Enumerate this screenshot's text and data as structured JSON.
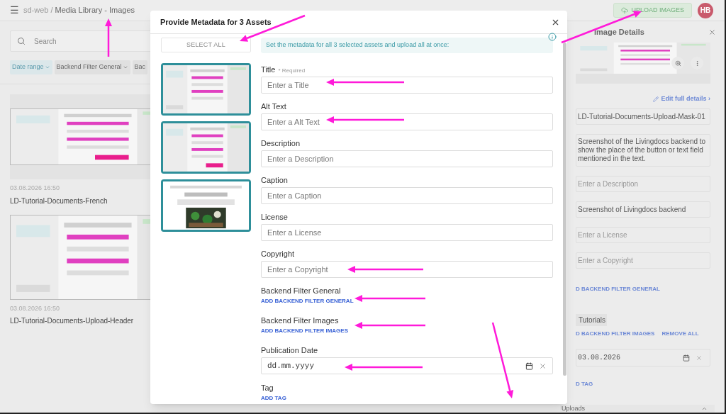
{
  "header": {
    "menu": "☰",
    "breadcrumb_root": "sd-web",
    "breadcrumb_separator": "/",
    "breadcrumb_page": "Media Library - Images",
    "upload_button": "UPLOAD IMAGES",
    "avatar": "HB"
  },
  "search": {
    "placeholder": "Search"
  },
  "filters": [
    {
      "label": "Date range",
      "selected": true
    },
    {
      "label": "Backend Filter General",
      "selected": false
    },
    {
      "label": "Bac",
      "selected": false
    }
  ],
  "assets": [
    {
      "kind": "picture",
      "date": "03.08.2026 16:50",
      "name": "LD-Tutorial-Documents-French"
    },
    {
      "kind": "picture",
      "date": "03.08.2026 16:50",
      "name": "LD-Tutorial-Documents-Upload-Header"
    }
  ],
  "details_panel": {
    "title": "Image Details",
    "edit_link": "Edit full details ›",
    "fields": [
      {
        "kind": "input",
        "value": "LD-Tutorial-Documents-Upload-Mask-01"
      },
      {
        "kind": "textarea",
        "value": "Screenshot of the Livingdocs backend to show the place of the button or text field mentioned in the text."
      },
      {
        "kind": "input",
        "placeholder": "Enter a Description"
      },
      {
        "kind": "input",
        "value": "Screenshot of Livingdocs backend"
      },
      {
        "kind": "input",
        "placeholder": "Enter a License"
      },
      {
        "kind": "input",
        "placeholder": "Enter a Copyright"
      },
      {
        "kind": "link",
        "links": [
          "D BACKEND FILTER GENERAL"
        ]
      },
      {
        "kind": "chips",
        "chips": [
          "Tutorials"
        ],
        "links": [
          "D BACKEND FILTER IMAGES",
          "REMOVE ALL"
        ]
      },
      {
        "kind": "date",
        "value": "03.08.2026"
      },
      {
        "kind": "link",
        "links": [
          "D TAG"
        ]
      }
    ]
  },
  "uploads_bar": {
    "label": "Uploads"
  },
  "modal": {
    "title": "Provide Metadata for 3 Assets",
    "select_all": "SELECT ALL",
    "info": "Set the metadata for all 3 selected assets and upload all at once:",
    "thumbnails": [
      {
        "selected": true
      },
      {
        "selected": true
      },
      {
        "selected": true
      }
    ],
    "fields": [
      {
        "kind": "input",
        "label": "Title",
        "required_note": "* Required",
        "placeholder": "Enter a Title"
      },
      {
        "kind": "input",
        "label": "Alt Text",
        "placeholder": "Enter a Alt Text"
      },
      {
        "kind": "input",
        "label": "Description",
        "placeholder": "Enter a Description"
      },
      {
        "kind": "input",
        "label": "Caption",
        "placeholder": "Enter a Caption"
      },
      {
        "kind": "input",
        "label": "License",
        "placeholder": "Enter a License"
      },
      {
        "kind": "input",
        "label": "Copyright",
        "placeholder": "Enter a Copyright"
      },
      {
        "kind": "link",
        "label": "Backend Filter General",
        "action": "ADD BACKEND FILTER GENERAL"
      },
      {
        "kind": "link",
        "label": "Backend Filter Images",
        "action": "ADD BACKEND FILTER IMAGES"
      },
      {
        "kind": "date",
        "label": "Publication Date",
        "placeholder": "dd.mm.yyyy"
      },
      {
        "kind": "link",
        "label": "Tag",
        "action": "ADD TAG"
      }
    ]
  }
}
